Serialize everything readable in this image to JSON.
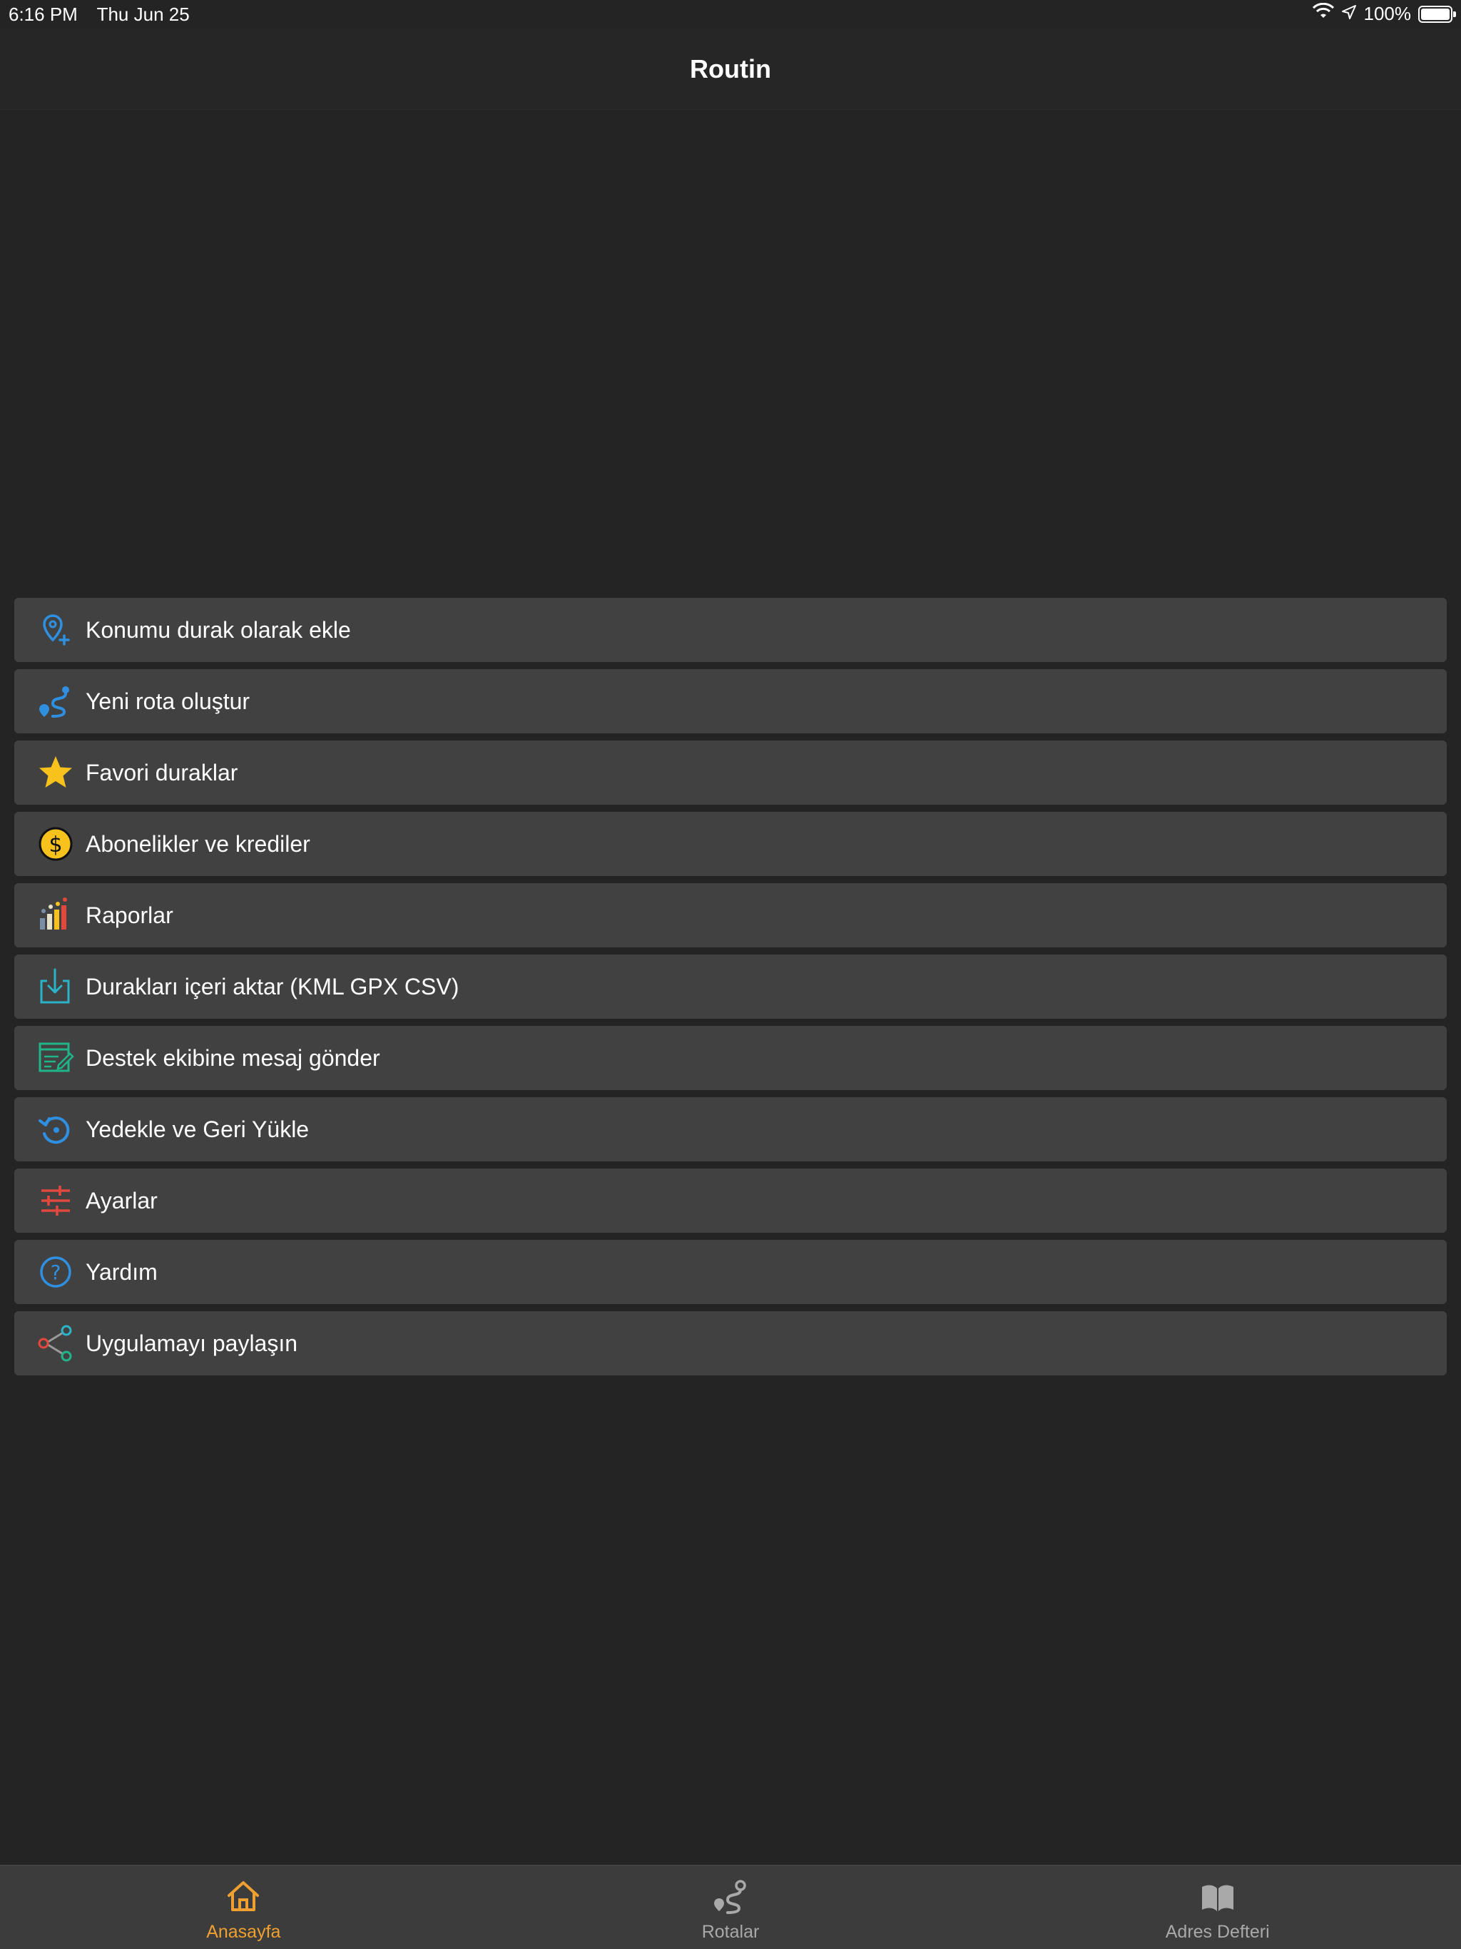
{
  "status_bar": {
    "time": "6:16 PM",
    "date": "Thu Jun 25",
    "battery_text": "100%",
    "icons": [
      "wifi-icon",
      "location-icon",
      "battery-icon"
    ]
  },
  "nav": {
    "title": "Routin"
  },
  "menu": {
    "items": [
      {
        "label": "Konumu durak olarak ekle",
        "icon": "location-plus-icon"
      },
      {
        "label": "Yeni rota oluştur",
        "icon": "route-icon"
      },
      {
        "label": "Favori duraklar",
        "icon": "star-icon"
      },
      {
        "label": "Abonelikler ve krediler",
        "icon": "dollar-coin-icon"
      },
      {
        "label": "Raporlar",
        "icon": "bar-chart-icon"
      },
      {
        "label": "Durakları içeri aktar (KML GPX CSV)",
        "icon": "import-icon"
      },
      {
        "label": "Destek ekibine mesaj gönder",
        "icon": "message-edit-icon"
      },
      {
        "label": "Yedekle ve Geri Yükle",
        "icon": "backup-restore-icon"
      },
      {
        "label": "Ayarlar",
        "icon": "sliders-icon"
      },
      {
        "label": "Yardım",
        "icon": "help-icon"
      },
      {
        "label": "Uygulamayı paylaşın",
        "icon": "share-icon"
      }
    ]
  },
  "tab_bar": {
    "tabs": [
      {
        "label": "Anasayfa",
        "icon": "home-icon",
        "active": true
      },
      {
        "label": "Rotalar",
        "icon": "route-icon",
        "active": false
      },
      {
        "label": "Adres Defteri",
        "icon": "book-icon",
        "active": false
      }
    ]
  },
  "colors": {
    "background": "#242424",
    "row": "#414141",
    "accent": "#f0a030",
    "blue": "#2f8fe0",
    "star": "#f7c21b",
    "red": "#e2493c"
  }
}
